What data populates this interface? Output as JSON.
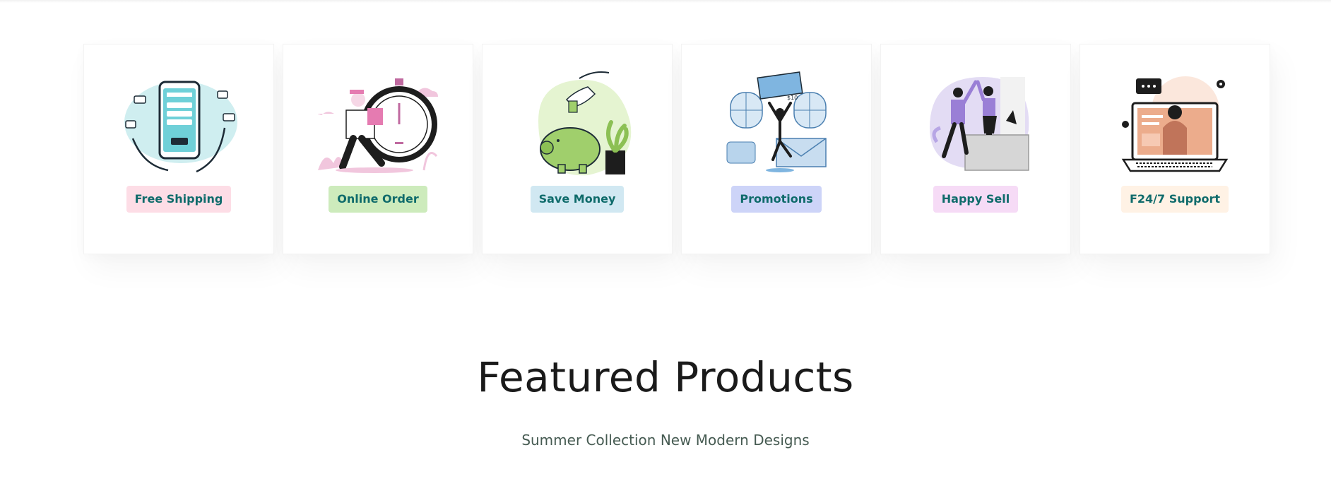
{
  "features": [
    {
      "label": "Free Shipping",
      "badge_color": "#fddde6",
      "icon": "mobile-payment-icon"
    },
    {
      "label": "Online Order",
      "badge_color": "#cdebbc",
      "icon": "delivery-stopwatch-icon"
    },
    {
      "label": "Save Money",
      "badge_color": "#d1e8f2",
      "icon": "piggy-bank-icon"
    },
    {
      "label": "Promotions",
      "badge_color": "#cdd4f8",
      "icon": "gift-voucher-icon"
    },
    {
      "label": "Happy Sell",
      "badge_color": "#f6dbf6",
      "icon": "high-five-icon"
    },
    {
      "label": "F24/7 Support",
      "badge_color": "#fff2e5",
      "icon": "support-laptop-icon"
    }
  ],
  "section": {
    "title": "Featured Products",
    "subtitle": "Summer Collection New Modern Designs"
  }
}
